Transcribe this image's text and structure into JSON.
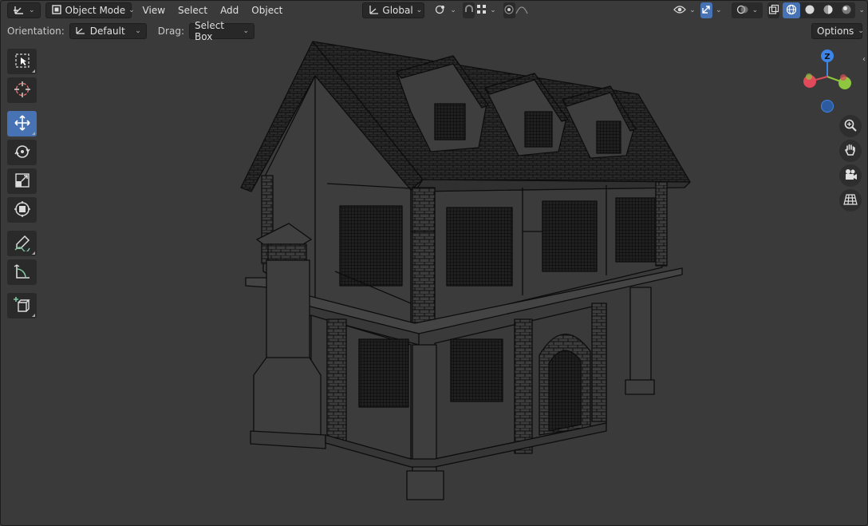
{
  "header": {
    "editor_type_icon": "axes-editor-icon",
    "mode_label": "Object Mode",
    "menus": [
      "View",
      "Select",
      "Add",
      "Object"
    ],
    "transform_orientation": "Global",
    "pivot_icon": "pivot-point-icon",
    "snap_icon": "magnet-icon",
    "proportional_icon": "proportional-edit-icon",
    "visibility_icon": "eye-icon",
    "gizmo_icon": "gizmo-arrows-icon",
    "overlay_icon": "overlay-circles-icon",
    "xray_icon": "xray-icon",
    "shading_modes": [
      "wireframe",
      "solid",
      "material",
      "rendered"
    ],
    "active_shading": "wireframe"
  },
  "toolsettings": {
    "orientation_label": "Orientation:",
    "orientation_value": "Default",
    "drag_label": "Drag:",
    "drag_value": "Select Box",
    "options_label": "Options"
  },
  "toolbar": {
    "tools": [
      {
        "name": "select-box-tool",
        "icon": "select-box-icon",
        "active": false
      },
      {
        "name": "cursor-tool",
        "icon": "cursor-icon",
        "active": false
      },
      {
        "name": "move-tool",
        "icon": "move-icon",
        "active": true
      },
      {
        "name": "rotate-tool",
        "icon": "rotate-icon",
        "active": false
      },
      {
        "name": "scale-tool",
        "icon": "scale-icon",
        "active": false
      },
      {
        "name": "transform-tool",
        "icon": "transform-icon",
        "active": false
      },
      {
        "name": "annotate-tool",
        "icon": "annotate-icon",
        "active": false
      },
      {
        "name": "measure-tool",
        "icon": "measure-icon",
        "active": false
      },
      {
        "name": "add-cube-tool",
        "icon": "add-cube-icon",
        "active": false
      }
    ]
  },
  "gizmo": {
    "z_label": "Z",
    "colors": {
      "x": "#e04a5a",
      "y": "#8ec63f",
      "z": "#3d86e8"
    }
  },
  "navigation": [
    "zoom-icon",
    "hand-pan-icon",
    "camera-icon",
    "grid-ortho-icon"
  ],
  "colors": {
    "background": "#3a3a3a",
    "accent": "#4772b3",
    "wire": "#0d0d0d"
  }
}
